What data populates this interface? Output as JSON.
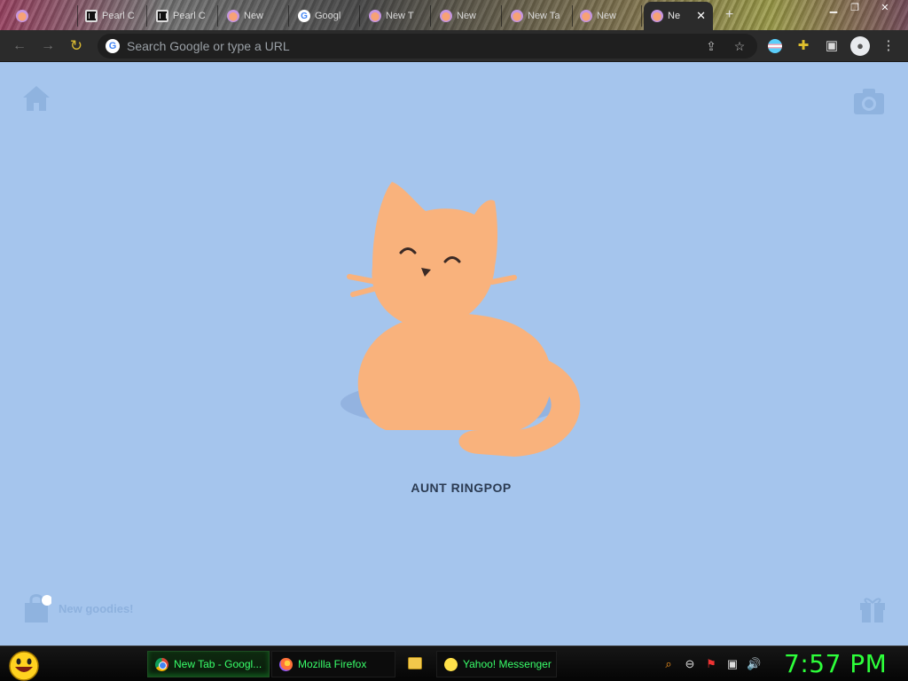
{
  "tabs": [
    {
      "label": "",
      "favicon": "cat-icon",
      "active": false
    },
    {
      "label": "Pearl C",
      "favicon": "library-icon",
      "active": false
    },
    {
      "label": "Pearl C",
      "favicon": "library-icon",
      "active": false
    },
    {
      "label": "New",
      "favicon": "cat-icon",
      "active": false
    },
    {
      "label": "Googl",
      "favicon": "google-icon",
      "active": false
    },
    {
      "label": "New T",
      "favicon": "cat-icon",
      "active": false
    },
    {
      "label": "New",
      "favicon": "cat-icon",
      "active": false
    },
    {
      "label": "New Ta",
      "favicon": "cat-icon",
      "active": false
    },
    {
      "label": "New",
      "favicon": "cat-icon",
      "active": false
    },
    {
      "label": "Ne",
      "favicon": "cat-icon",
      "active": true
    }
  ],
  "toolbar": {
    "omnibox_placeholder": "Search Google or type a URL"
  },
  "page": {
    "cat_name": "AUNT RINGPOP",
    "goodies_label": "New goodies!",
    "background_color": "#a5c5ed",
    "cat_color": "#f9b27c"
  },
  "taskbar": {
    "tasks": [
      {
        "label": "New Tab - Googl...",
        "icon": "chrome-icon",
        "active": true
      },
      {
        "label": "Mozilla Firefox",
        "icon": "firefox-icon",
        "active": false
      },
      {
        "label": "Yahoo! Messenger",
        "icon": "yahoo-messenger-icon",
        "active": false
      }
    ],
    "clock": "7:57 PM"
  }
}
